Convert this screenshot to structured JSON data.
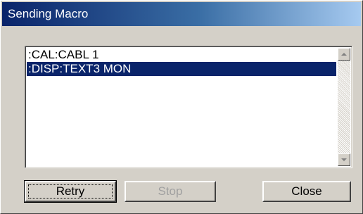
{
  "window": {
    "title": "Sending Macro"
  },
  "list": {
    "items": [
      {
        "text": ":CAL:CABL 1",
        "selected": false
      },
      {
        "text": ":DISP:TEXT3 MON",
        "selected": true
      }
    ]
  },
  "buttons": {
    "retry": "Retry",
    "stop": "Stop",
    "close": "Close"
  },
  "colors": {
    "titlebar_start": "#0a246a",
    "titlebar_end": "#a6caf0",
    "selection": "#0a246a",
    "face": "#d4d0c8"
  }
}
